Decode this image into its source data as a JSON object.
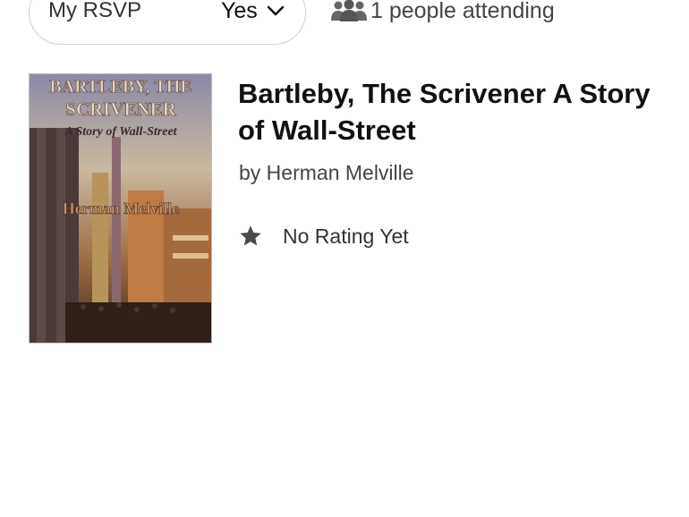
{
  "rsvp": {
    "label": "My RSVP",
    "value": "Yes"
  },
  "attendance": {
    "text": "1 people attending",
    "icon": "people-icon"
  },
  "book": {
    "title": "Bartleby, The Scrivener A Story of Wall-Street",
    "author": "by Herman Melville",
    "rating_text": "No Rating Yet",
    "rating_icon": "star-icon",
    "cover": {
      "title_line1": "BARTLEBY, THE",
      "title_line2": "SCRIVENER",
      "subtitle": "A Story of Wall-Street",
      "author": "Herman Melville"
    }
  },
  "colors": {
    "pill_border": "#cfcfcf",
    "text_primary": "#111111",
    "text_secondary": "#444444"
  }
}
